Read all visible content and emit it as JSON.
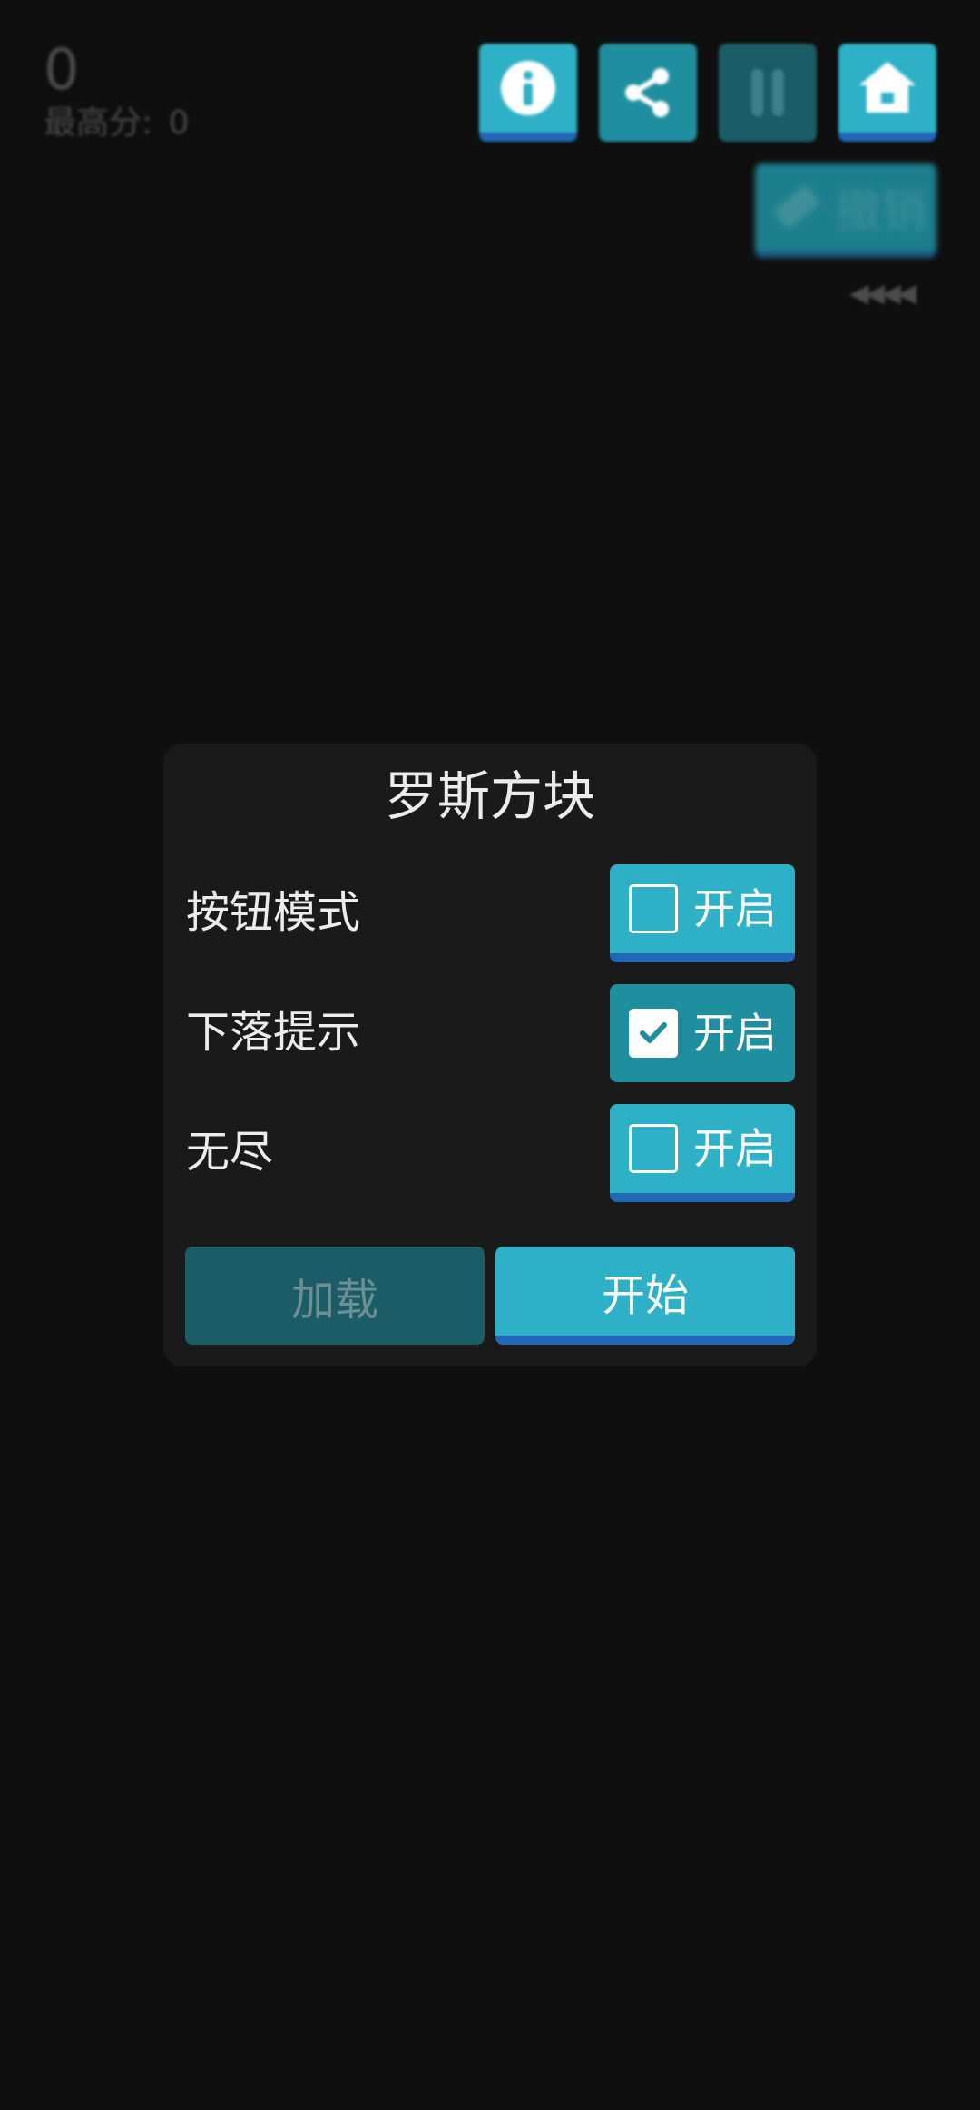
{
  "game": {
    "score": "0",
    "best_label": "最高分:",
    "best_value": "0",
    "undo_label": "撤销",
    "arrows": "◀◀◀◀"
  },
  "toolbar": {
    "icons": [
      "info-icon",
      "share-icon",
      "pause-icon",
      "home-icon"
    ]
  },
  "dialog": {
    "title": "罗斯方块",
    "options": [
      {
        "label": "按钮模式",
        "button_text": "开启",
        "checked": false
      },
      {
        "label": "下落提示",
        "button_text": "开启",
        "checked": true
      },
      {
        "label": "无尽",
        "button_text": "开启",
        "checked": false
      }
    ],
    "load_label": "加载",
    "start_label": "开始"
  },
  "colors": {
    "background": "#0f0f0f",
    "dialog": "#1a1a1a",
    "accent": "#2eb0c6",
    "accent_shadow": "#2168b8",
    "active_toggle": "#1f8e9e",
    "disabled": "#1b5c66"
  }
}
